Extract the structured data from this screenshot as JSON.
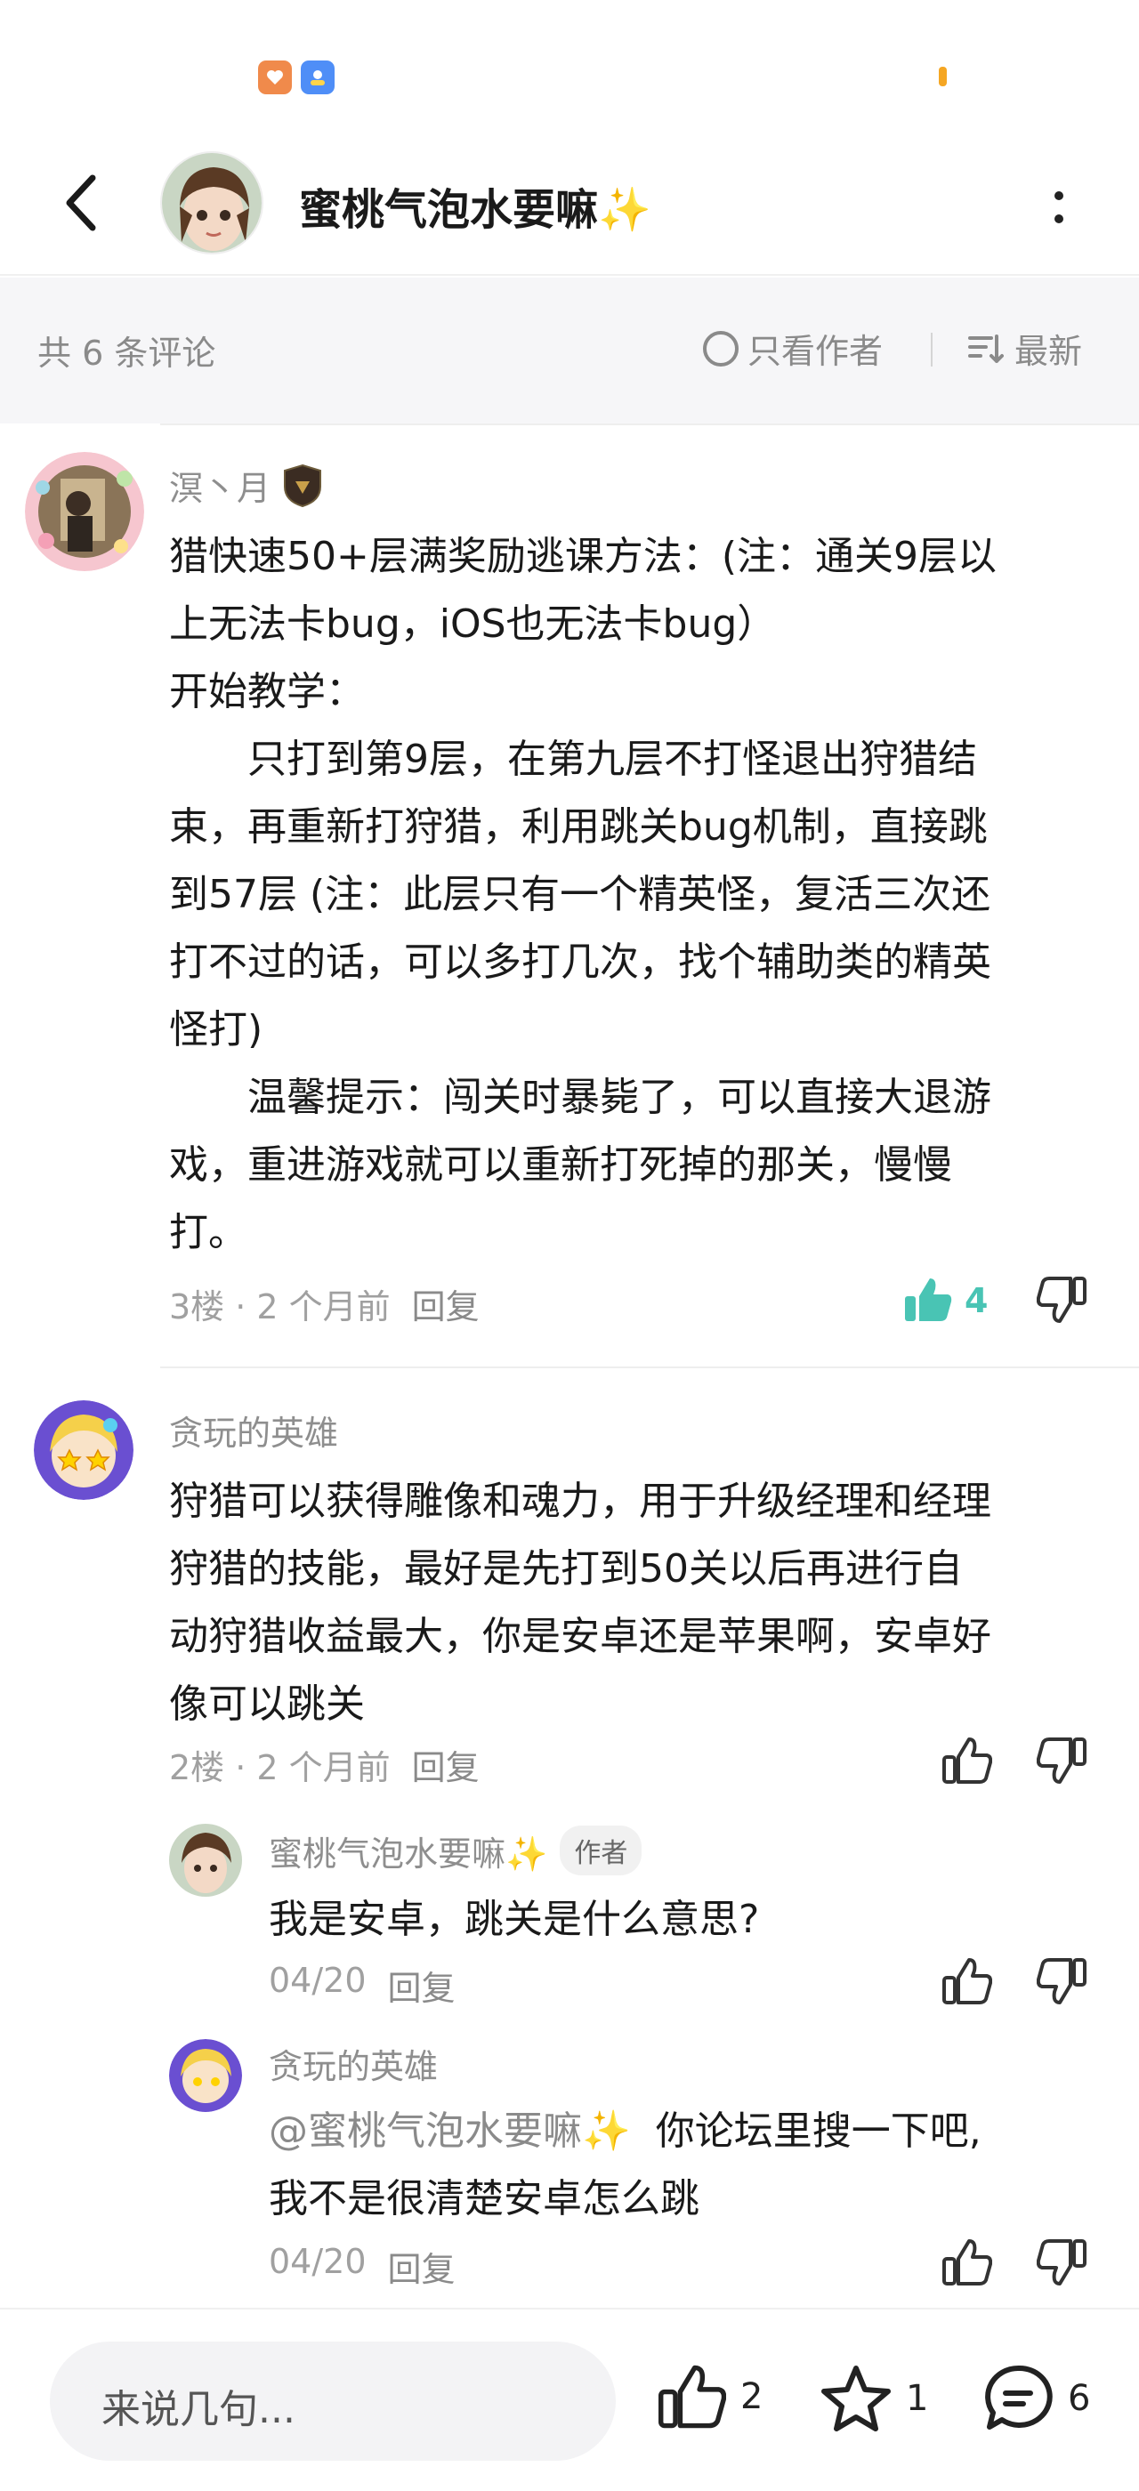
{
  "header": {
    "title": "蜜桃气泡水要嘛✨"
  },
  "filter_bar": {
    "comment_count": "共 6 条评论",
    "only_author": "只看作者",
    "sort": "最新"
  },
  "comments": [
    {
      "user": "溟丶月",
      "lines": [
        "猎快速50+层满奖励逃课方法：(注：通关9层以",
        "上无法卡bug，iOS也无法卡bug）",
        "开始教学：",
        "　　只打到第9层，在第九层不打怪退出狩猎结",
        "束，再重新打狩猎，利用跳关bug机制，直接跳",
        "到57层 (注：此层只有一个精英怪，复活三次还",
        "打不过的话，可以多打几次，找个辅助类的精英",
        "怪打)",
        "　　温馨提示：闯关时暴毙了，可以直接大退游",
        "戏，重进游戏就可以重新打死掉的那关，慢慢",
        "打。"
      ],
      "floor_time": "3楼 · 2 个月前",
      "reply": "回复",
      "likes": "4"
    },
    {
      "user": "贪玩的英雄",
      "lines": [
        "狩猎可以获得雕像和魂力，用于升级经理和经理",
        "狩猎的技能，最好是先打到50关以后再进行自",
        "动狩猎收益最大，你是安卓还是苹果啊，安卓好",
        "像可以跳关"
      ],
      "floor_time": "2楼 · 2 个月前",
      "reply": "回复"
    }
  ],
  "replies": [
    {
      "user": "蜜桃气泡水要嘛✨",
      "tag": "作者",
      "text": "我是安卓，跳关是什么意思?",
      "date": "04/20",
      "reply": "回复"
    },
    {
      "user": "贪玩的英雄",
      "mention": "@蜜桃气泡水要嘛✨",
      "text_line1": "你论坛里搜一下吧,",
      "text_line2": "我不是很清楚安卓怎么跳",
      "date": "04/20",
      "reply": "回复"
    }
  ],
  "bottom_bar": {
    "input_placeholder": "来说几句...",
    "like_count": "2",
    "star_count": "1",
    "comment_count": "6"
  },
  "colors": {
    "accent_like": "#49c4b4",
    "status_dot": "#f5a623"
  }
}
